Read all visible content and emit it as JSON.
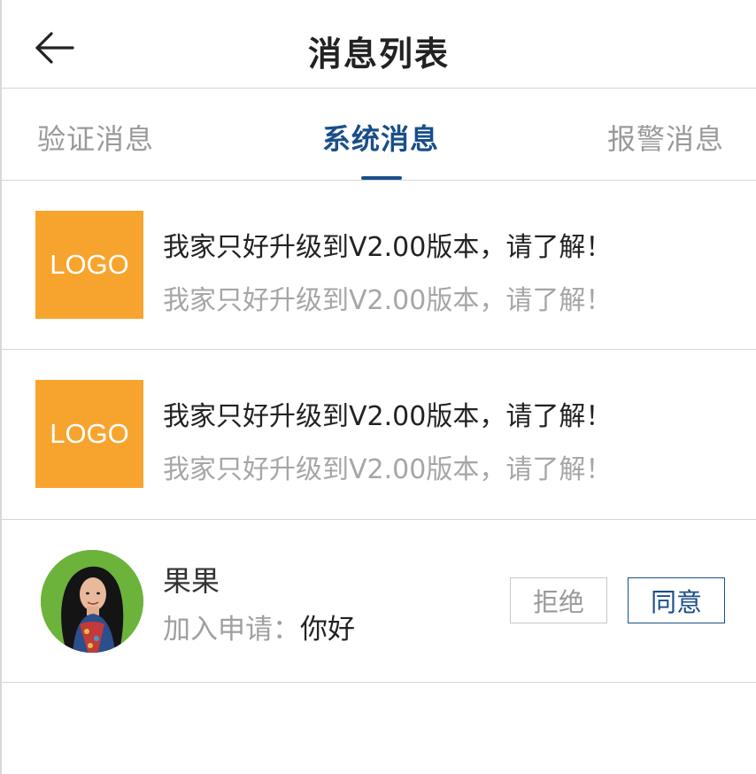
{
  "header": {
    "title": "消息列表",
    "back_icon": "arrow-left-icon"
  },
  "tabs": [
    {
      "label": "验证消息",
      "active": false
    },
    {
      "label": "系统消息",
      "active": true
    },
    {
      "label": "报警消息",
      "active": false
    }
  ],
  "colors": {
    "accent": "#1a4e8a",
    "logo_bg": "#f7a42f",
    "muted": "#a0a0a0"
  },
  "messages": [
    {
      "logo": "LOGO",
      "title": "我家只好升级到V2.00版本，请了解！",
      "subtitle": "我家只好升级到V2.00版本，请了解！"
    },
    {
      "logo": "LOGO",
      "title": "我家只好升级到V2.00版本，请了解！",
      "subtitle": "我家只好升级到V2.00版本，请了解！"
    }
  ],
  "request": {
    "name": "果果",
    "label": "加入申请：",
    "message": "你好",
    "reject_label": "拒绝",
    "accept_label": "同意"
  }
}
